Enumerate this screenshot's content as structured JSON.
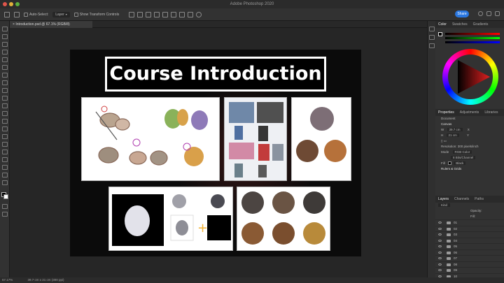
{
  "app": {
    "title": "Adobe Photoshop 2020"
  },
  "options_bar": {
    "auto_select_label": "Auto-Select:",
    "auto_select_value": "Layer",
    "transform_label": "Show Transform Controls",
    "share_label": "Share"
  },
  "document": {
    "tab_label": "Introduction.psd @ 67.1% (RGB/8)",
    "heading": "Course Introduction"
  },
  "color_panel": {
    "tabs": [
      "Color",
      "Swatches",
      "Gradients"
    ]
  },
  "properties_panel": {
    "tabs": [
      "Properties",
      "Adjustments",
      "Libraries"
    ],
    "document_label": "Document",
    "canvas_label": "Canvas",
    "width": "39.7 cm",
    "height": "21 cm",
    "x_label": "X",
    "y_label": "Y",
    "w_label": "W",
    "h_label": "H",
    "resolution": "Resolution: 300 pixels/inch",
    "mode_label": "Mode",
    "mode_value": "RGB Color",
    "depth_value": "8 Bits/Channel",
    "fill_label": "Fill",
    "fill_value": "Black",
    "rulers_label": "Rulers & Grids"
  },
  "layers_panel": {
    "tabs": [
      "Layers",
      "Channels",
      "Paths"
    ],
    "kind_label": "Kind",
    "opacity_label": "Opacity:",
    "fill_label": "Fill:",
    "layers": [
      "01",
      "02",
      "03",
      "04",
      "05",
      "06",
      "07",
      "08",
      "09",
      "10"
    ]
  },
  "status": {
    "zoom": "67.17%",
    "size": "39.7 cm x 21 cm (300 ppi)"
  }
}
